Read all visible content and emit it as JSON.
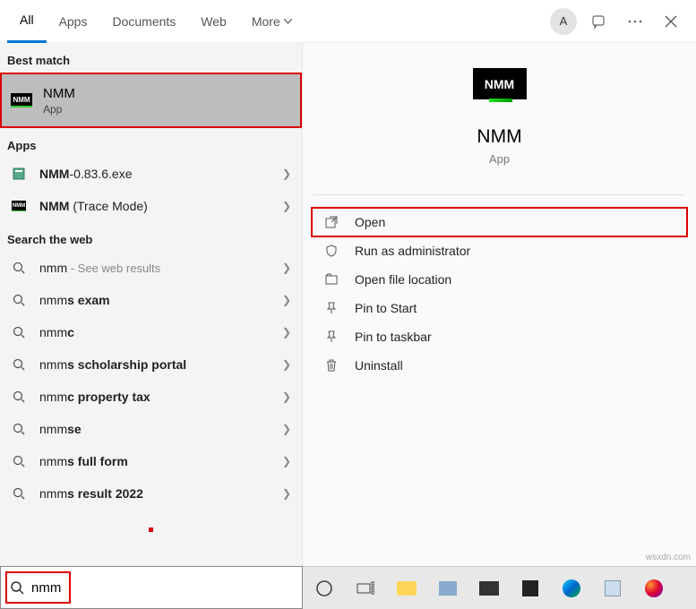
{
  "tabs": {
    "all": "All",
    "apps": "Apps",
    "documents": "Documents",
    "web": "Web",
    "more": "More"
  },
  "avatar_initial": "A",
  "sections": {
    "best_match": "Best match",
    "apps": "Apps",
    "web": "Search the web"
  },
  "best_match": {
    "icon_text": "NMM",
    "title": "NMM",
    "subtitle": "App"
  },
  "app_results": [
    {
      "prefix": "NMM",
      "suffix": "-0.83.6.exe",
      "icon": "exe"
    },
    {
      "prefix": "NMM",
      "suffix": " (Trace Mode)",
      "icon": "nmm"
    }
  ],
  "web_results": [
    {
      "prefix": "nmm",
      "bold": "",
      "suffix": " - See web results",
      "dim_suffix": true
    },
    {
      "prefix": "nmm",
      "bold": "s exam",
      "suffix": ""
    },
    {
      "prefix": "nmm",
      "bold": "c",
      "suffix": ""
    },
    {
      "prefix": "nmm",
      "bold": "s scholarship portal",
      "suffix": ""
    },
    {
      "prefix": "nmm",
      "bold": "c property tax",
      "suffix": ""
    },
    {
      "prefix": "nmm",
      "bold": "se",
      "suffix": ""
    },
    {
      "prefix": "nmm",
      "bold": "s full form",
      "suffix": ""
    },
    {
      "prefix": "nmm",
      "bold": "s result 2022",
      "suffix": ""
    }
  ],
  "detail": {
    "icon_text": "NMM",
    "title": "NMM",
    "subtitle": "App",
    "actions": {
      "open": "Open",
      "run_admin": "Run as administrator",
      "open_loc": "Open file location",
      "pin_start": "Pin to Start",
      "pin_taskbar": "Pin to taskbar",
      "uninstall": "Uninstall"
    }
  },
  "search": {
    "value": "nmm"
  },
  "watermark": "wsxdn.com"
}
